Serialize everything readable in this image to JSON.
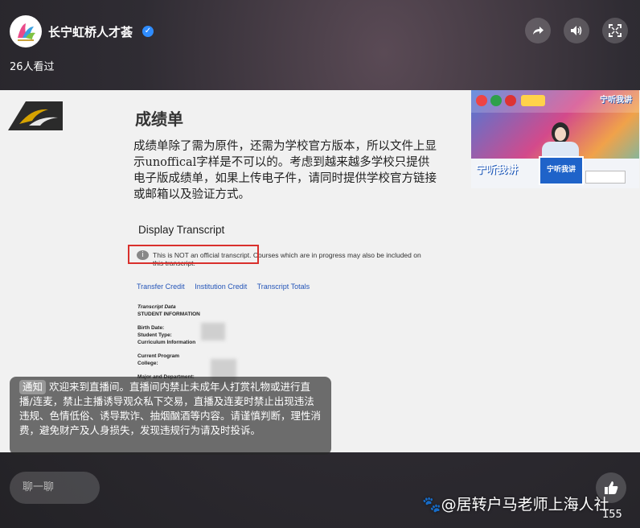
{
  "header": {
    "channel_name": "长宁虹桥人才荟",
    "verified_icon": "check-badge-icon",
    "viewers_text": "26人看过",
    "buttons": [
      {
        "name": "share-button",
        "icon": "share-arrow-icon"
      },
      {
        "name": "volume-button",
        "icon": "speaker-icon"
      },
      {
        "name": "fullscreen-button",
        "icon": "fullscreen-icon"
      }
    ]
  },
  "slide": {
    "title": "成绩单",
    "body": "成绩单除了需为原件，还需为学校官方版本，所以文件上显示unoffical字样是不可以的。考虑到越来越多学校只提供电子版成绩单，如果上传电子件，请同时提供学校官方链接或邮箱以及验证方式。",
    "transcript": {
      "heading": "Display Transcript",
      "notice": "This is NOT an official transcript. Courses which are in progress may also be included on this transcript.",
      "links": [
        "Transfer Credit",
        "Institution Credit",
        "Transcript Totals"
      ],
      "data_title": "Transcript Data",
      "student_info": "STUDENT INFORMATION",
      "fields": [
        "Birth Date:",
        "Student Type:"
      ],
      "curriculum": "Curriculum Information",
      "program_fields": [
        "Current Program",
        "College:"
      ],
      "major": "Major and Department:"
    }
  },
  "pip": {
    "tag_top": "宁听我讲",
    "tag_left": "宁听我讲",
    "podium": "宁听我讲"
  },
  "notice": {
    "tag": "通知",
    "text": "欢迎来到直播间。直播间内禁止未成年人打赏礼物或进行直播/连麦，禁止主播诱导观众私下交易，直播及连麦时禁止出现违法违规、色情低俗、诱导欺诈、抽烟酗酒等内容。请谨慎判断，理性消费，避免财产及人身损失，发现违规行为请及时投诉。"
  },
  "footer": {
    "chat_placeholder": "聊一聊",
    "like_count": "155",
    "watermark": "@居转户马老师上海人社",
    "like_icon": "thumbs-up-icon"
  }
}
